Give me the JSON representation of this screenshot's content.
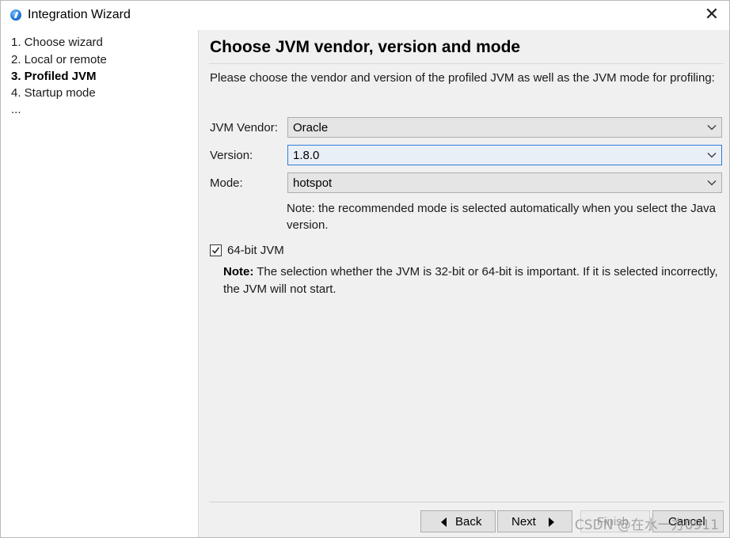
{
  "window": {
    "title": "Integration Wizard",
    "close_symbol": "✕",
    "icon": "app-logo-icon"
  },
  "sidebar": {
    "steps": [
      {
        "label": "1. Choose wizard",
        "active": false
      },
      {
        "label": "2. Local or remote",
        "active": false
      },
      {
        "label": "3. Profiled JVM",
        "active": true
      },
      {
        "label": "4. Startup mode",
        "active": false
      },
      {
        "label": "...",
        "active": false
      }
    ]
  },
  "main": {
    "title": "Choose JVM vendor, version and mode",
    "description": "Please choose the vendor and version of the profiled JVM as well as the JVM mode for profiling:",
    "fields": {
      "vendor": {
        "label": "JVM Vendor:",
        "value": "Oracle"
      },
      "version": {
        "label": "Version:",
        "value": "1.8.0"
      },
      "mode": {
        "label": "Mode:",
        "value": "hotspot"
      }
    },
    "mode_note": "Note: the recommended mode is selected automatically when you select the Java version.",
    "checkbox": {
      "label": "64-bit JVM",
      "checked": true
    },
    "note_bold": "Note:",
    "note_text": " The selection whether the JVM is 32-bit or 64-bit is important. If it is selected incorrectly, the JVM will not start."
  },
  "buttons": {
    "back": "Back",
    "next": "Next",
    "finish": "Finish",
    "cancel": "Cancel"
  },
  "watermark": "CSDN @在水一方0911",
  "colors": {
    "focus_border": "#2f7ed8",
    "window_bg": "#f0f0f0"
  }
}
